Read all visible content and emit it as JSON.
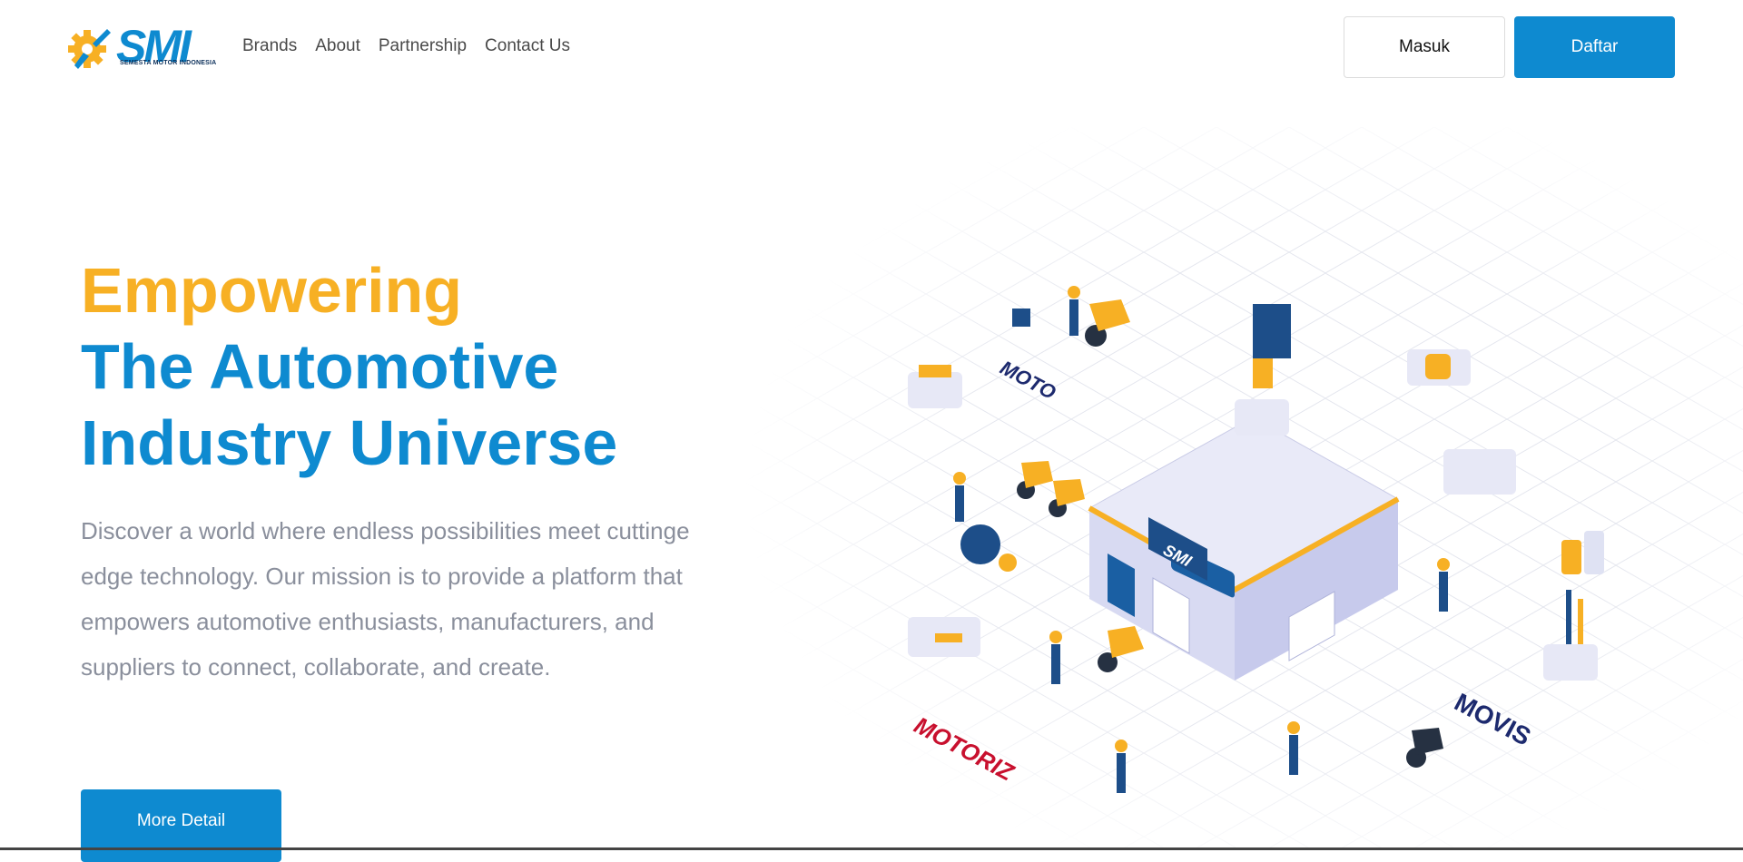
{
  "brand": {
    "name": "SMI",
    "tagline": "SEMESTA MOTOR INDONESIA"
  },
  "nav": {
    "links": [
      {
        "label": "Brands"
      },
      {
        "label": "About"
      },
      {
        "label": "Partnership"
      },
      {
        "label": "Contact Us"
      }
    ],
    "login_label": "Masuk",
    "register_label": "Daftar"
  },
  "hero": {
    "title_line1": "Empowering",
    "title_line2": "The Automotive",
    "title_line3": "Industry Universe",
    "description": "Discover a world where endless possibilities meet cuttinge edge technology. Our mission is to provide a platform that empowers automotive enthusiasts, manufacturers, and suppliers to connect, collaborate, and create.",
    "cta_label": "More Detail"
  },
  "illustration": {
    "labels": [
      "MOTO",
      "SMI",
      "MOTORIZ",
      "MOVIS"
    ]
  },
  "colors": {
    "primary": "#0e8ad0",
    "accent": "#f7b024",
    "text_muted": "#8a8f9c"
  }
}
